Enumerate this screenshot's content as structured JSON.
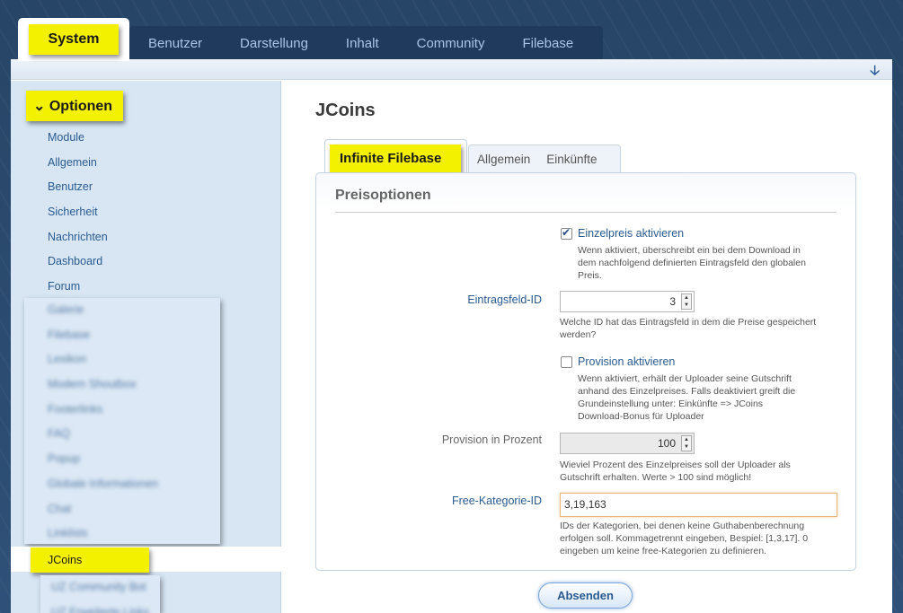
{
  "topnav": {
    "active": "System",
    "tabs": [
      "Benutzer",
      "Darstellung",
      "Inhalt",
      "Community",
      "Filebase"
    ]
  },
  "sidebar": {
    "section": "Optionen",
    "items": [
      "Module",
      "Allgemein",
      "Benutzer",
      "Sicherheit",
      "Nachrichten",
      "Dashboard",
      "Forum"
    ],
    "blurred_items": [
      "Galerie",
      "Filebase",
      "Lexikon",
      "Modern Shoutbox",
      "Footerlinks",
      "FAQ",
      "Popup",
      "Globale Informationen",
      "Chat",
      "Linklists"
    ],
    "active_item": "JCoins",
    "blurred_items_bottom": [
      "UZ Community Bot",
      "UZ Erweiterte Links"
    ]
  },
  "page": {
    "title": "JCoins",
    "tabs": {
      "active": "Infinite Filebase",
      "others": [
        "Allgemein",
        "Einkünfte"
      ]
    }
  },
  "form": {
    "section_title": "Preisoptionen",
    "single_price": {
      "label": "Einzelpreis aktivieren",
      "checked": true,
      "desc": [
        "Wenn aktiviert, überschreibt ein bei dem Download in",
        "dem nachfolgend definierten Eintragsfeld den globalen",
        "Preis."
      ]
    },
    "field_id": {
      "label": "Eintragsfeld-ID",
      "value": "3",
      "desc": [
        "Welche ID hat das Eintragsfeld in dem die Preise gespeichert",
        "werden?"
      ]
    },
    "provision": {
      "label": "Provision aktivieren",
      "checked": false,
      "desc": [
        "Wenn aktiviert, erhält der Uploader seine Gutschrift",
        "anhand des Einzelpreises. Falls deaktiviert greift die",
        "Grundeinstellung unter: Einkünfte => JCoins",
        "Download-Bonus für Uploader"
      ]
    },
    "provision_percent": {
      "label": "Provision in Prozent",
      "value": "100",
      "desc": [
        "Wieviel Prozent des Einzelpreises soll der Uploader als",
        "Gutschrift erhalten. Werte > 100 sind möglich!"
      ]
    },
    "free_category": {
      "label": "Free-Kategorie-ID",
      "value": "3,19,163",
      "desc": [
        "IDs der Kategorien, bei denen keine Guthabenberechnung",
        "erfolgen soll. Kommagetrennt eingeben, Bespiel: [1,3,17]. 0",
        "eingeben um keine free-Kategorien zu definieren."
      ]
    },
    "submit": "Absenden"
  },
  "colors": {
    "highlight": "#f3f000",
    "link_blue": "#2a5b8f",
    "header_bg": "#1f3a5c"
  }
}
